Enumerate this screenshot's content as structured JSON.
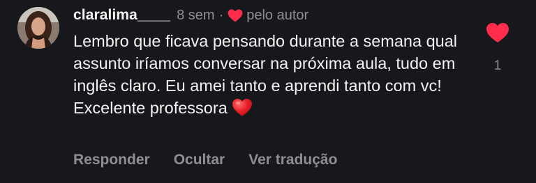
{
  "comment": {
    "username": "claralima____",
    "time": "8 sem",
    "separator": "·",
    "liked_by_author": "pelo autor",
    "text": "Lembro que ficava pensando durante a semana qual assunto iríamos conversar na próxima aula, tudo em inglês claro. Eu amei tanto e aprendi tanto com vc! Excelente professora",
    "emoji": "heart-emoji",
    "like_count": "1",
    "actions": {
      "reply": "Responder",
      "hide": "Ocultar",
      "translate": "Ver tradução"
    }
  },
  "colors": {
    "background": "#17181c",
    "text": "#f3f3f3",
    "muted": "#8e8e93",
    "heart": "#ff2d4b"
  },
  "icons": {
    "author_like": "heart-icon",
    "like_button": "heart-icon",
    "avatar": "user-avatar"
  }
}
